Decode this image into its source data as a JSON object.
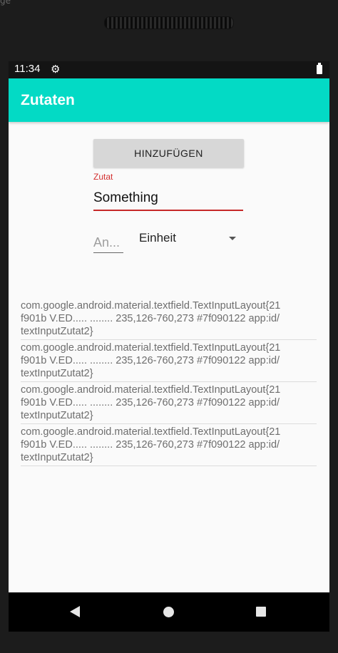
{
  "device": {
    "corner_label": "ge"
  },
  "status_bar": {
    "time": "11:34",
    "settings_icon": "gear-icon",
    "battery_icon": "battery-icon"
  },
  "app_bar": {
    "title": "Zutaten"
  },
  "form": {
    "add_button_label": "HINZUFÜGEN",
    "ingredient_label": "Zutat",
    "ingredient_value": "Something",
    "amount_placeholder": "An...",
    "unit_selected": "Einheit"
  },
  "list": {
    "items": [
      {
        "lines": [
          "com.google.android.material.textfield.TextInputLayout{21",
          "f901b V.ED..... ........ 235,126-760,273 #7f090122 app:id/",
          "textInputZutat2}"
        ]
      },
      {
        "lines": [
          "com.google.android.material.textfield.TextInputLayout{21",
          "f901b V.ED..... ........ 235,126-760,273 #7f090122 app:id/",
          "textInputZutat2}"
        ]
      },
      {
        "lines": [
          "com.google.android.material.textfield.TextInputLayout{21",
          "f901b V.ED..... ........ 235,126-760,273 #7f090122 app:id/",
          "textInputZutat2}"
        ]
      },
      {
        "lines": [
          "com.google.android.material.textfield.TextInputLayout{21",
          "f901b V.ED..... ........ 235,126-760,273 #7f090122 app:id/",
          "textInputZutat2}"
        ]
      }
    ]
  },
  "nav_bar": {
    "back_icon": "back-triangle-icon",
    "home_icon": "home-circle-icon",
    "recents_icon": "recents-square-icon"
  },
  "colors": {
    "accent": "#03dac5",
    "error": "#d32f2f"
  }
}
